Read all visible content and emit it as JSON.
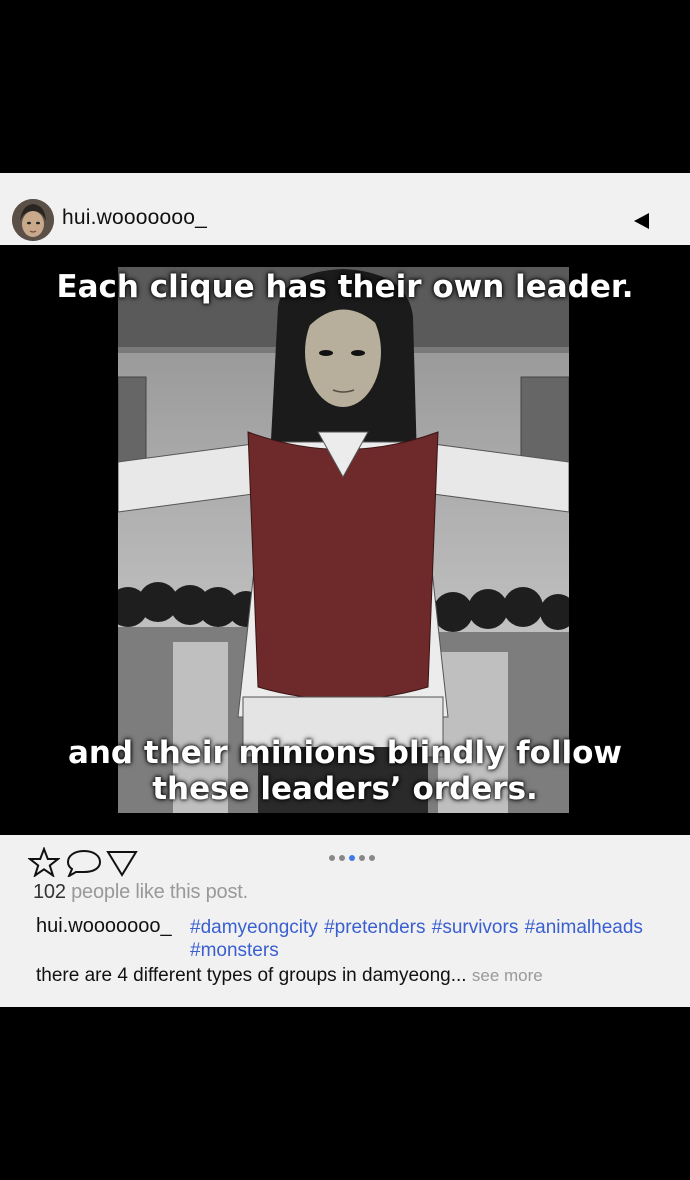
{
  "post": {
    "username": "hui.wooooooo_",
    "captions": {
      "top": "Each clique has their own leader.",
      "bottom": "and their minions blindly follow\nthese leaders’ orders."
    },
    "carousel": {
      "total": 5,
      "active_index": 3
    },
    "likes": {
      "count": "102",
      "suffix": " people like this post."
    },
    "caption": {
      "username": "hui.wooooooo_",
      "hashtags": "#damyeongcity #pretenders #survivors #animalheads #monsters",
      "text": "there are 4 different types of groups in damyeong... ",
      "see_more": "see more"
    }
  },
  "icons": {
    "back": "back-arrow-icon",
    "like": "star-icon",
    "comment": "comment-bubble-icon",
    "share": "share-triangle-icon"
  },
  "colors": {
    "hashtag": "#3a5fd0",
    "active_dot": "#3d7ce8",
    "vest": "#6e2a2a"
  }
}
